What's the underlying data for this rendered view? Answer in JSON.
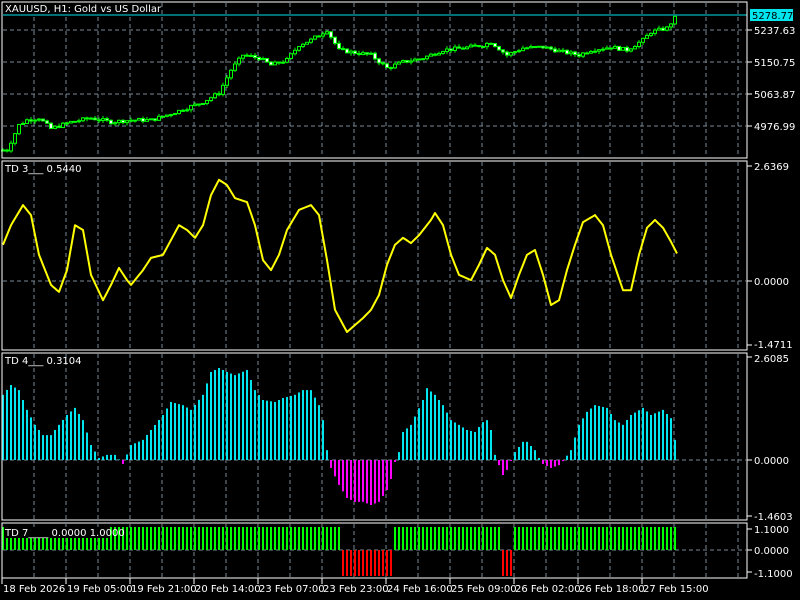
{
  "window": {
    "title": "XAUUSD, H1:  Gold vs US Dollar",
    "current_price": "5278.77"
  },
  "colors": {
    "background": "#000000",
    "grid": "#778899",
    "candle": "#00ff00",
    "price_line": "#00e5ee",
    "td3_line": "#ffff00",
    "td4_pos": "#00e5ee",
    "td4_neg": "#ff00ff",
    "td7_pos": "#00ff00",
    "td7_neg": "#ff0000"
  },
  "price_axis": [
    "5237.63",
    "5150.75",
    "5063.87",
    "4976.99"
  ],
  "td3": {
    "label": "TD 3___  0.5440",
    "axis": [
      "2.6369",
      "0.0000",
      "-1.4711"
    ]
  },
  "td4": {
    "label": "TD 4___  0.3104",
    "axis": [
      "2.6085",
      "0.0000",
      "-1.4603"
    ]
  },
  "td7": {
    "label": "TD 7____  0.0000  1.0000",
    "axis": [
      "1.1000",
      "0.0000",
      "-1.1000"
    ]
  },
  "time_axis": [
    "18 Feb 2026",
    "19 Feb 05:00",
    "19 Feb 21:00",
    "20 Feb 14:00",
    "23 Feb 07:00",
    "23 Feb 23:00",
    "24 Feb 16:00",
    "25 Feb 09:00",
    "26 Feb 02:00",
    "26 Feb 18:00",
    "27 Feb 15:00"
  ],
  "chart_data": {
    "type": "line",
    "bars": 169,
    "price_close_keypoints": [
      [
        1,
        4911.8
      ],
      [
        4,
        4979.7
      ],
      [
        6,
        4993.2
      ],
      [
        9,
        4998.7
      ],
      [
        12,
        4970
      ],
      [
        17,
        4987.9
      ],
      [
        22,
        4998.7
      ],
      [
        27,
        4987.9
      ],
      [
        32,
        4993.2
      ],
      [
        37,
        4993.2
      ],
      [
        41,
        5006.8
      ],
      [
        46,
        5025.9
      ],
      [
        50,
        5042.2
      ],
      [
        54,
        5066.6
      ],
      [
        57,
        5129
      ],
      [
        60,
        5169.8
      ],
      [
        64,
        5161.6
      ],
      [
        67,
        5142.6
      ],
      [
        71,
        5156.2
      ],
      [
        74,
        5196.9
      ],
      [
        77,
        5210.5
      ],
      [
        81,
        5237.6
      ],
      [
        84,
        5183.3
      ],
      [
        87,
        5177.9
      ],
      [
        92,
        5169.8
      ],
      [
        96,
        5134.5
      ],
      [
        100,
        5150.7
      ],
      [
        105,
        5161.6
      ],
      [
        110,
        5183.3
      ],
      [
        115,
        5188.7
      ],
      [
        120,
        5196.9
      ],
      [
        122,
        5205
      ],
      [
        126,
        5169.8
      ],
      [
        130,
        5188.7
      ],
      [
        135,
        5191.5
      ],
      [
        140,
        5177.9
      ],
      [
        144,
        5169.8
      ],
      [
        147,
        5183.3
      ],
      [
        152,
        5191.5
      ],
      [
        156,
        5183.3
      ],
      [
        160,
        5210.5
      ],
      [
        162,
        5232.2
      ],
      [
        166,
        5243
      ],
      [
        168,
        5270.2
      ]
    ],
    "td3_keypoints": [
      [
        0,
        0.83
      ],
      [
        2,
        1.28
      ],
      [
        5,
        1.74
      ],
      [
        7,
        1.51
      ],
      [
        9,
        0.6
      ],
      [
        12,
        -0.09
      ],
      [
        14,
        -0.25
      ],
      [
        16,
        0.25
      ],
      [
        18,
        1.28
      ],
      [
        20,
        1.17
      ],
      [
        22,
        0.14
      ],
      [
        25,
        -0.44
      ],
      [
        27,
        -0.09
      ],
      [
        29,
        0.3
      ],
      [
        31,
        0.02
      ],
      [
        32,
        -0.09
      ],
      [
        35,
        0.25
      ],
      [
        37,
        0.53
      ],
      [
        40,
        0.6
      ],
      [
        42,
        0.94
      ],
      [
        44,
        1.28
      ],
      [
        46,
        1.17
      ],
      [
        48,
        0.99
      ],
      [
        50,
        1.28
      ],
      [
        52,
        1.97
      ],
      [
        54,
        2.32
      ],
      [
        56,
        2.2
      ],
      [
        58,
        1.9
      ],
      [
        61,
        1.81
      ],
      [
        63,
        1.28
      ],
      [
        65,
        0.48
      ],
      [
        67,
        0.25
      ],
      [
        69,
        0.6
      ],
      [
        71,
        1.17
      ],
      [
        74,
        1.63
      ],
      [
        77,
        1.74
      ],
      [
        79,
        1.51
      ],
      [
        81,
        0.48
      ],
      [
        83,
        -0.66
      ],
      [
        86,
        -1.17
      ],
      [
        88,
        -1.01
      ],
      [
        90,
        -0.85
      ],
      [
        92,
        -0.66
      ],
      [
        94,
        -0.32
      ],
      [
        96,
        0.37
      ],
      [
        98,
        0.83
      ],
      [
        100,
        0.99
      ],
      [
        102,
        0.87
      ],
      [
        104,
        1.05
      ],
      [
        107,
        1.4
      ],
      [
        108,
        1.56
      ],
      [
        110,
        1.28
      ],
      [
        112,
        0.6
      ],
      [
        114,
        0.14
      ],
      [
        117,
        0.02
      ],
      [
        119,
        0.37
      ],
      [
        121,
        0.76
      ],
      [
        123,
        0.6
      ],
      [
        125,
        0.02
      ],
      [
        127,
        -0.39
      ],
      [
        129,
        0.14
      ],
      [
        131,
        0.6
      ],
      [
        133,
        0.71
      ],
      [
        135,
        0.14
      ],
      [
        137,
        -0.55
      ],
      [
        139,
        -0.44
      ],
      [
        141,
        0.25
      ],
      [
        143,
        0.83
      ],
      [
        145,
        1.35
      ],
      [
        148,
        1.51
      ],
      [
        150,
        1.28
      ],
      [
        152,
        0.6
      ],
      [
        155,
        -0.21
      ],
      [
        157,
        -0.21
      ],
      [
        159,
        0.6
      ],
      [
        161,
        1.22
      ],
      [
        163,
        1.4
      ],
      [
        165,
        1.22
      ],
      [
        167,
        0.9
      ],
      [
        169,
        0.54
      ]
    ],
    "td4_keypoints": [
      [
        0,
        1.65
      ],
      [
        2,
        1.9
      ],
      [
        4,
        1.77
      ],
      [
        6,
        1.27
      ],
      [
        8,
        0.89
      ],
      [
        10,
        0.63
      ],
      [
        12,
        0.63
      ],
      [
        14,
        0.89
      ],
      [
        16,
        1.14
      ],
      [
        18,
        1.32
      ],
      [
        20,
        1.01
      ],
      [
        22,
        0.38
      ],
      [
        24,
        0.05
      ],
      [
        26,
        0.13
      ],
      [
        28,
        0.13
      ],
      [
        30,
        -0.1
      ],
      [
        32,
        0.38
      ],
      [
        35,
        0.51
      ],
      [
        37,
        0.76
      ],
      [
        40,
        1.14
      ],
      [
        42,
        1.47
      ],
      [
        45,
        1.39
      ],
      [
        47,
        1.27
      ],
      [
        50,
        1.65
      ],
      [
        52,
        2.23
      ],
      [
        54,
        2.33
      ],
      [
        56,
        2.23
      ],
      [
        58,
        2.15
      ],
      [
        61,
        2.28
      ],
      [
        63,
        1.77
      ],
      [
        65,
        1.52
      ],
      [
        68,
        1.47
      ],
      [
        70,
        1.57
      ],
      [
        73,
        1.65
      ],
      [
        75,
        1.77
      ],
      [
        77,
        1.77
      ],
      [
        79,
        1.39
      ],
      [
        80,
        1.01
      ],
      [
        81,
        0.25
      ],
      [
        82,
        -0.2
      ],
      [
        84,
        -0.63
      ],
      [
        86,
        -0.96
      ],
      [
        88,
        -1.06
      ],
      [
        90,
        -1.06
      ],
      [
        92,
        -1.14
      ],
      [
        94,
        -1.06
      ],
      [
        96,
        -0.76
      ],
      [
        97,
        -0.48
      ],
      [
        98,
        -0.05
      ],
      [
        99,
        0.2
      ],
      [
        100,
        0.71
      ],
      [
        102,
        0.89
      ],
      [
        105,
        1.52
      ],
      [
        106,
        1.82
      ],
      [
        108,
        1.65
      ],
      [
        110,
        1.39
      ],
      [
        112,
        1.01
      ],
      [
        114,
        0.89
      ],
      [
        116,
        0.76
      ],
      [
        118,
        0.71
      ],
      [
        120,
        0.96
      ],
      [
        121,
        1.01
      ],
      [
        122,
        0.76
      ],
      [
        123,
        0.13
      ],
      [
        124,
        -0.13
      ],
      [
        125,
        -0.38
      ],
      [
        126,
        -0.25
      ],
      [
        128,
        0.2
      ],
      [
        130,
        0.46
      ],
      [
        131,
        0.46
      ],
      [
        133,
        0.25
      ],
      [
        134,
        0.05
      ],
      [
        135,
        -0.1
      ],
      [
        137,
        -0.2
      ],
      [
        139,
        -0.13
      ],
      [
        140,
        -0.03
      ],
      [
        142,
        0.25
      ],
      [
        144,
        0.89
      ],
      [
        146,
        1.22
      ],
      [
        148,
        1.39
      ],
      [
        151,
        1.32
      ],
      [
        153,
        1.01
      ],
      [
        155,
        0.89
      ],
      [
        157,
        1.14
      ],
      [
        160,
        1.32
      ],
      [
        162,
        1.14
      ],
      [
        165,
        1.27
      ],
      [
        167,
        1.06
      ],
      [
        168,
        0.51
      ]
    ],
    "td7_negative_ranges": [
      [
        85,
        97
      ],
      [
        125,
        127
      ]
    ]
  }
}
